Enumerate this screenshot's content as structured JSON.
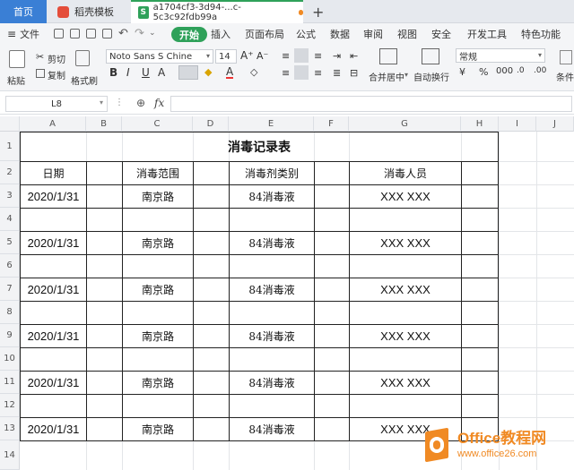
{
  "tabs": {
    "home": "首页",
    "template": "稻壳模板",
    "document": "a1704cf3-3d94-...c-5c3c92fdb99a",
    "new_tab": "+"
  },
  "menu": {
    "file": "文件",
    "items": [
      "开始",
      "插入",
      "页面布局",
      "公式",
      "数据",
      "审阅",
      "视图",
      "安全",
      "开发工具",
      "特色功能"
    ]
  },
  "ribbon": {
    "paste": "粘贴",
    "cut": "剪切",
    "copy": "复制",
    "format_painter": "格式刷",
    "font_name": "Noto Sans S Chine",
    "font_size": "14",
    "merge_center": "合并居中",
    "wrap_text": "自动换行",
    "number_format": "常规",
    "conditional": "条件"
  },
  "formula_bar": {
    "name_box": "L8",
    "fx": "fx",
    "value": ""
  },
  "columns": [
    "A",
    "B",
    "C",
    "D",
    "E",
    "F",
    "G",
    "H",
    "I",
    "J"
  ],
  "rows": [
    "1",
    "2",
    "3",
    "4",
    "5",
    "6",
    "7",
    "8",
    "9",
    "10",
    "11",
    "12",
    "13",
    "14"
  ],
  "sheet": {
    "title": "消毒记录表",
    "headers": {
      "date": "日期",
      "area": "消毒范围",
      "agent": "消毒剂类别",
      "person": "消毒人员"
    },
    "records": [
      {
        "date": "2020/1/31",
        "area": "南京路",
        "agent": "84消毒液",
        "person": "XXX XXX"
      },
      {
        "date": "2020/1/31",
        "area": "南京路",
        "agent": "84消毒液",
        "person": "XXX XXX"
      },
      {
        "date": "2020/1/31",
        "area": "南京路",
        "agent": "84消毒液",
        "person": "XXX XXX"
      },
      {
        "date": "2020/1/31",
        "area": "南京路",
        "agent": "84消毒液",
        "person": "XXX XXX"
      },
      {
        "date": "2020/1/31",
        "area": "南京路",
        "agent": "84消毒液",
        "person": "XXX XXX"
      },
      {
        "date": "2020/1/31",
        "area": "南京路",
        "agent": "84消毒液",
        "person": "XXX XXX"
      }
    ]
  },
  "watermark": {
    "brand": "Office教程网",
    "url": "www.office26.com"
  },
  "colors": {
    "accent_green": "#2fa15a",
    "tab_blue": "#3a7fd5",
    "watermark_orange": "#f08a24"
  }
}
